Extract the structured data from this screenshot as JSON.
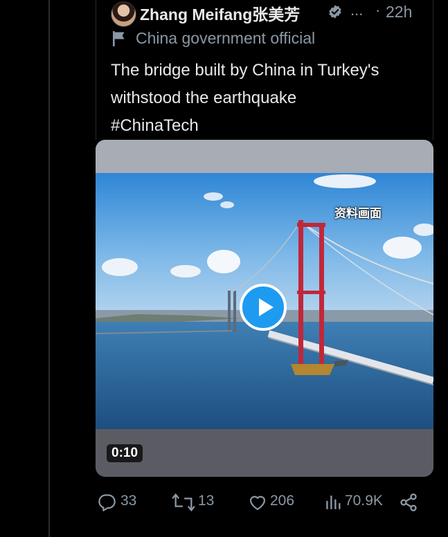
{
  "tweet": {
    "author_name": "Zhang Meifang张美芳",
    "more": "...",
    "separator": "·",
    "time": "22h",
    "label": "China government official",
    "text_lines": [
      "The bridge built by China in Turkey's",
      "withstood the earthquake",
      "#ChinaTech"
    ]
  },
  "media": {
    "watermark": "资料画面",
    "duration": "0:10"
  },
  "actions": {
    "replies": "33",
    "reposts": "13",
    "likes": "206",
    "views": "70.9K"
  },
  "colors": {
    "background": "#000000",
    "text": "#e7e9ea",
    "secondary": "#8b98a5",
    "accent": "#1d9bf0"
  },
  "icons": [
    "flag-icon",
    "verified-badge-icon",
    "play-icon",
    "reply-icon",
    "repost-icon",
    "like-icon",
    "views-icon",
    "share-icon"
  ]
}
